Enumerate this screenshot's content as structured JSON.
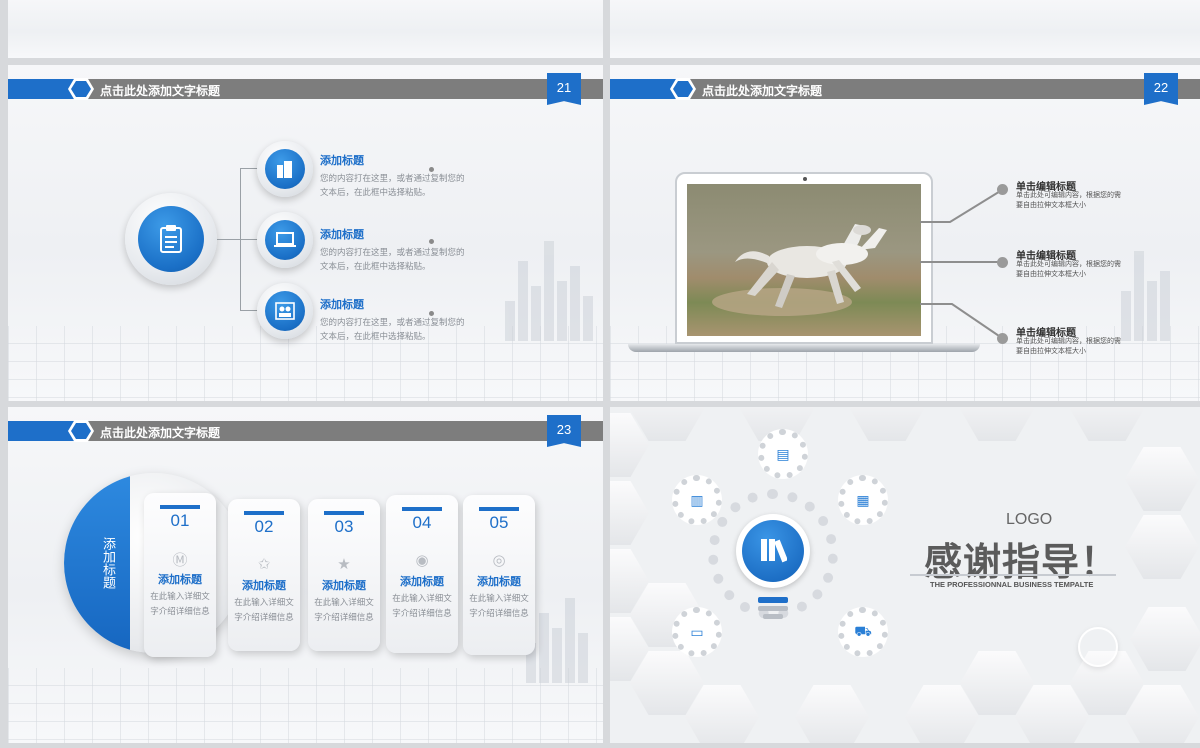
{
  "slides": [
    {
      "number": "21",
      "header_title": "点击此处添加文字标题",
      "items": [
        {
          "title": "添加标题",
          "desc": [
            "您的内容打在这里，或者通过复制您的",
            "文本后，在此框中选择粘贴。"
          ]
        },
        {
          "title": "添加标题",
          "desc": [
            "您的内容打在这里，或者通过复制您的",
            "文本后，在此框中选择粘贴。"
          ]
        },
        {
          "title": "添加标题",
          "desc": [
            "您的内容打在这里，或者通过复制您的",
            "文本后，在此框中选择粘贴。"
          ]
        }
      ]
    },
    {
      "number": "22",
      "header_title": "点击此处添加文字标题",
      "items": [
        {
          "title": "单击编辑标题",
          "desc": [
            "单击此处可编辑内容，根据您的需",
            "要自由拉伸文本框大小"
          ]
        },
        {
          "title": "单击编辑标题",
          "desc": [
            "单击此处可编辑内容，根据您的需",
            "要自由拉伸文本框大小"
          ]
        },
        {
          "title": "单击编辑标题",
          "desc": [
            "单击此处可编辑内容，根据您的需",
            "要自由拉伸文本框大小"
          ]
        }
      ]
    },
    {
      "number": "23",
      "header_title": "点击此处添加文字标题",
      "side_label": "添加标题",
      "cards": [
        {
          "num": "01",
          "icon": "mi-icon",
          "title": "添加标题",
          "desc": [
            "在此输入详细文",
            "字介绍详细信息"
          ]
        },
        {
          "num": "02",
          "icon": "star-icon",
          "title": "添加标题",
          "desc": [
            "在此输入详细文",
            "字介绍详细信息"
          ]
        },
        {
          "num": "03",
          "icon": "star-icon",
          "title": "添加标题",
          "desc": [
            "在此输入详细文",
            "字介绍详细信息"
          ]
        },
        {
          "num": "04",
          "icon": "wechat-icon",
          "title": "添加标题",
          "desc": [
            "在此输入详细文",
            "字介绍详细信息"
          ]
        },
        {
          "num": "05",
          "icon": "weibo-icon",
          "title": "添加标题",
          "desc": [
            "在此输入详细文",
            "字介绍详细信息"
          ]
        }
      ]
    },
    {
      "logo": "LOGO",
      "thanks": "感谢指导！",
      "tagline": "THE PROFESSIONNAL BUSINESS TEMPALTE"
    }
  ],
  "colors": {
    "accent": "#1e6fc9",
    "header_grey": "#7d7d7d"
  }
}
